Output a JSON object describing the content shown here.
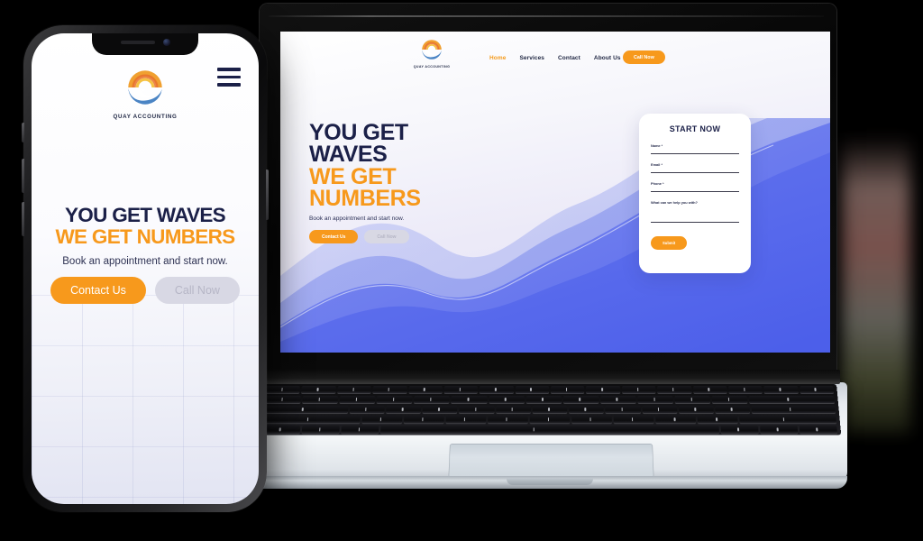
{
  "brand": {
    "name": "QUAY ACCOUNTING",
    "accent_orange": "#f7991c",
    "navy": "#1b2048",
    "wave_blue": "#5b6ef0"
  },
  "desktop": {
    "nav": {
      "links": [
        {
          "label": "Home",
          "active": true
        },
        {
          "label": "Services",
          "active": false
        },
        {
          "label": "Contact",
          "active": false
        },
        {
          "label": "About Us",
          "active": false
        }
      ],
      "cta_label": "Call Now"
    },
    "hero": {
      "line1": "YOU GET",
      "line2": "WAVES",
      "line3": "WE GET",
      "line4": "NUMBERS",
      "subtitle": "Book an appointment and start now.",
      "primary_button": "Contact Us",
      "secondary_button": "Call Now"
    },
    "form": {
      "title": "START NOW",
      "fields": [
        {
          "label": "Name *",
          "value": "",
          "placeholder": ""
        },
        {
          "label": "Email *",
          "value": "",
          "placeholder": ""
        },
        {
          "label": "Phone *",
          "value": "",
          "placeholder": ""
        },
        {
          "label": "What can we help you with?",
          "value": "",
          "placeholder": ""
        }
      ],
      "submit_label": "Submit"
    }
  },
  "mobile": {
    "menu_icon": "hamburger-icon",
    "hero": {
      "line1": "YOU GET WAVES",
      "line2": "WE GET NUMBERS",
      "subtitle": "Book an appointment and start now.",
      "primary_button": "Contact Us",
      "secondary_button": "Call Now"
    }
  }
}
